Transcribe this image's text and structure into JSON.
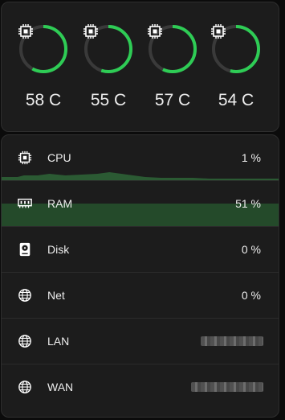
{
  "temperatures": [
    {
      "label": "58 C",
      "percent": 58
    },
    {
      "label": "55 C",
      "percent": 55
    },
    {
      "label": "57 C",
      "percent": 57
    },
    {
      "label": "54 C",
      "percent": 54
    }
  ],
  "colors": {
    "accent": "#2ecc55",
    "track": "#3a3a3a",
    "ram_fill": "#244a2a",
    "cpu_graph": "#2b5a33"
  },
  "stats": {
    "cpu": {
      "label": "CPU",
      "value": "1 %",
      "icon": "cpu-chip-icon"
    },
    "ram": {
      "label": "RAM",
      "value": "51 %",
      "percent": 51,
      "icon": "memory-icon"
    },
    "disk": {
      "label": "Disk",
      "value": "0 %",
      "icon": "disk-icon"
    },
    "net": {
      "label": "Net",
      "value": "0 %",
      "icon": "globe-icon"
    },
    "lan": {
      "label": "LAN",
      "icon": "globe-icon"
    },
    "wan": {
      "label": "WAN",
      "icon": "globe-icon"
    }
  }
}
